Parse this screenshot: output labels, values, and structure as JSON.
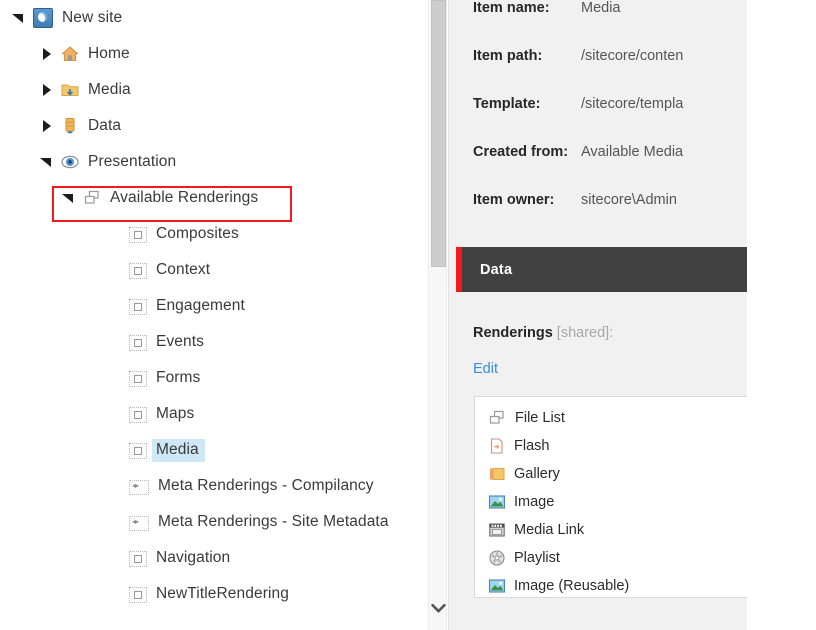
{
  "tree": {
    "items": [
      {
        "label": "New site",
        "icon": "globe-icon",
        "twisty": "open",
        "indent": 12,
        "selected": false
      },
      {
        "label": "Home",
        "icon": "house-icon",
        "twisty": "closed",
        "indent": 40,
        "selected": false
      },
      {
        "label": "Media",
        "icon": "media-folder-icon",
        "twisty": "closed",
        "indent": 40,
        "selected": false
      },
      {
        "label": "Data",
        "icon": "database-icon",
        "twisty": "closed",
        "indent": 40,
        "selected": false
      },
      {
        "label": "Presentation",
        "icon": "eye-icon",
        "twisty": "open",
        "indent": 40,
        "selected": false
      },
      {
        "label": "Available Renderings",
        "icon": "renderings-icon",
        "twisty": "open",
        "indent": 62,
        "selected": false
      },
      {
        "label": "Composites",
        "icon": "rendering-item-icon",
        "twisty": "none",
        "indent": 108,
        "selected": false
      },
      {
        "label": "Context",
        "icon": "rendering-item-icon",
        "twisty": "none",
        "indent": 108,
        "selected": false
      },
      {
        "label": "Engagement",
        "icon": "rendering-item-icon",
        "twisty": "none",
        "indent": 108,
        "selected": false
      },
      {
        "label": "Events",
        "icon": "rendering-item-icon",
        "twisty": "none",
        "indent": 108,
        "selected": false
      },
      {
        "label": "Forms",
        "icon": "rendering-item-icon",
        "twisty": "none",
        "indent": 108,
        "selected": false
      },
      {
        "label": "Maps",
        "icon": "rendering-item-icon",
        "twisty": "none",
        "indent": 108,
        "selected": false
      },
      {
        "label": "Media",
        "icon": "rendering-item-icon",
        "twisty": "none",
        "indent": 108,
        "selected": true
      },
      {
        "label": "Meta Renderings - Compilancy",
        "icon": "meta-rendering-icon",
        "twisty": "none",
        "indent": 108,
        "selected": false
      },
      {
        "label": "Meta Renderings - Site Metadata",
        "icon": "meta-rendering-icon",
        "twisty": "none",
        "indent": 108,
        "selected": false
      },
      {
        "label": "Navigation",
        "icon": "rendering-item-icon",
        "twisty": "none",
        "indent": 108,
        "selected": false
      },
      {
        "label": "NewTitleRendering",
        "icon": "rendering-item-icon",
        "twisty": "none",
        "indent": 108,
        "selected": false
      }
    ],
    "highlight_box_label": "Available Renderings"
  },
  "scrollbar": {
    "down_arrow_icon": "chevron-down-icon"
  },
  "panel": {
    "fields": [
      {
        "key": "Item name:",
        "value": "Media"
      },
      {
        "key": "Item path:",
        "value": "/sitecore/conten"
      },
      {
        "key": "Template:",
        "value": "/sitecore/templa"
      },
      {
        "key": "Created from:",
        "value": "Available Media"
      },
      {
        "key": "Item owner:",
        "value": "sitecore\\Admin"
      }
    ],
    "section_title": "Data",
    "renderings_label": "Renderings ",
    "renderings_shared": "[shared]:",
    "edit_link": "Edit",
    "renderings": [
      {
        "label": "File List",
        "icon": "renderings-icon"
      },
      {
        "label": "Flash",
        "icon": "flash-icon"
      },
      {
        "label": "Gallery",
        "icon": "gallery-icon"
      },
      {
        "label": "Image",
        "icon": "image-icon"
      },
      {
        "label": "Media Link",
        "icon": "media-link-icon"
      },
      {
        "label": "Playlist",
        "icon": "playlist-icon"
      },
      {
        "label": "Image (Reusable)",
        "icon": "image-icon"
      }
    ]
  },
  "colors": {
    "annotation_red": "#ee1c1c",
    "section_header_bg": "#414141",
    "section_accent": "#f01c1c",
    "selection_blue": "#cfe8f7",
    "link_blue": "#3a8dde",
    "panel_bg": "#f1f1f1"
  }
}
